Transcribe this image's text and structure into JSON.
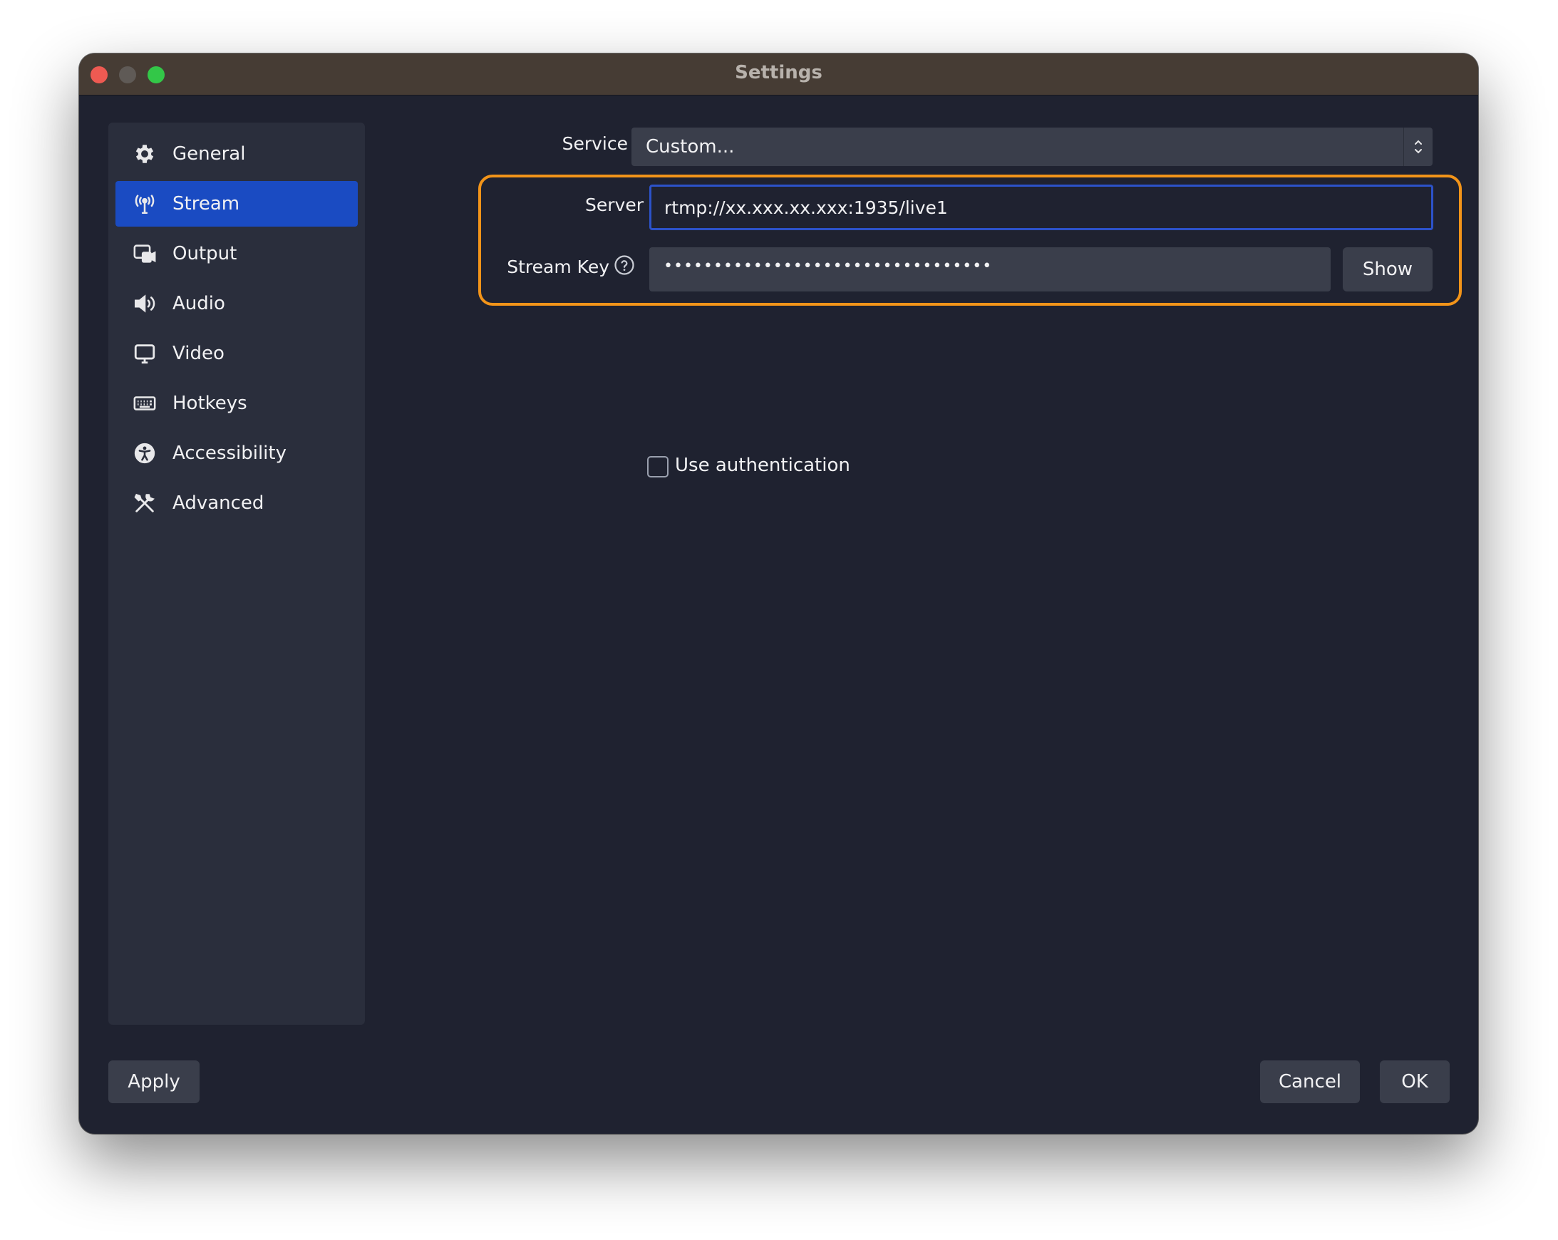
{
  "window": {
    "title": "Settings"
  },
  "sidebar": {
    "items": [
      {
        "label": "General",
        "icon": "gear-icon"
      },
      {
        "label": "Stream",
        "icon": "antenna-icon",
        "active": true
      },
      {
        "label": "Output",
        "icon": "output-icon"
      },
      {
        "label": "Audio",
        "icon": "speaker-icon"
      },
      {
        "label": "Video",
        "icon": "monitor-icon"
      },
      {
        "label": "Hotkeys",
        "icon": "keyboard-icon"
      },
      {
        "label": "Accessibility",
        "icon": "accessibility-icon"
      },
      {
        "label": "Advanced",
        "icon": "tools-icon"
      }
    ]
  },
  "stream": {
    "service_label": "Service",
    "service_value": "Custom...",
    "server_label": "Server",
    "server_value": "rtmp://xx.xxx.xx.xxx:1935/live1",
    "stream_key_label": "Stream Key",
    "stream_key_value": "•••••••••••••••••••••••••••••••••",
    "show_label": "Show",
    "use_auth_label": "Use authentication",
    "use_auth_checked": false
  },
  "footer": {
    "apply_label": "Apply",
    "cancel_label": "Cancel",
    "ok_label": "OK"
  },
  "colors": {
    "accent": "#1a4bc2",
    "highlight": "#f29419",
    "background": "#1f2230",
    "sidebar": "#2a2e3c"
  }
}
